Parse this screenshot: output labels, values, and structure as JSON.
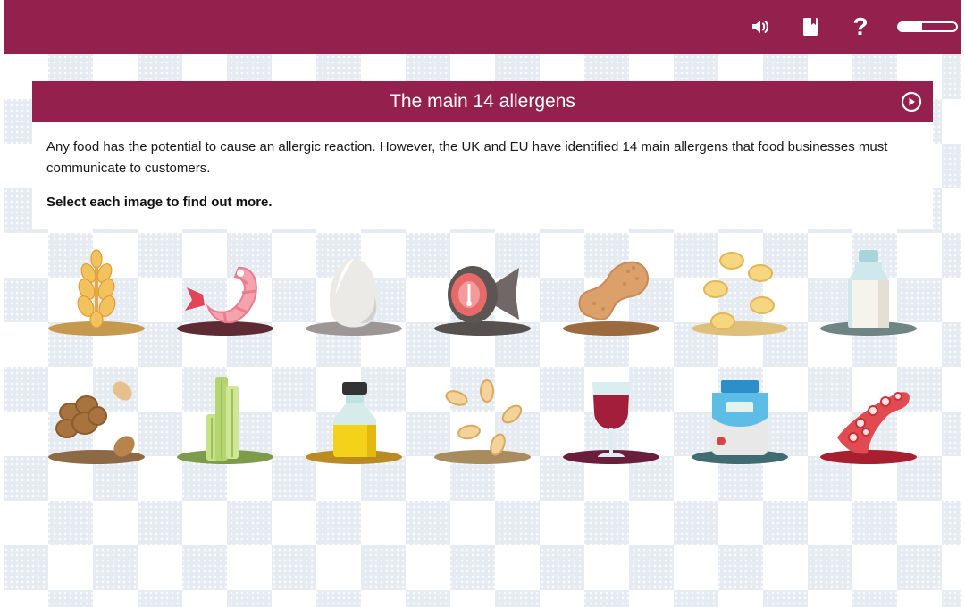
{
  "topbar": {
    "icons": [
      "speaker-icon",
      "bookmark-book-icon",
      "help-question-icon"
    ],
    "help_glyph": "?",
    "progress_fraction": 0.4,
    "color": "#93204d"
  },
  "card": {
    "title": "The main 14 allergens",
    "intro": "Any food has the potential to cause an allergic reaction. However, the UK and EU have identified 14 main allergens that food businesses must communicate to customers.",
    "instruction": "Select each image to find out more."
  },
  "allergens": [
    {
      "icon": "wheat-icon",
      "base_color": "#c69a4e"
    },
    {
      "icon": "prawn-icon",
      "base_color": "#5e2a33"
    },
    {
      "icon": "egg-icon",
      "base_color": "#9c9696"
    },
    {
      "icon": "fish-icon",
      "base_color": "#56504f"
    },
    {
      "icon": "peanut-icon",
      "base_color": "#9b6a3e"
    },
    {
      "icon": "soya-beans-icon",
      "base_color": "#dfc07a"
    },
    {
      "icon": "milk-bottle-icon",
      "base_color": "#6f8583"
    },
    {
      "icon": "nuts-icon",
      "base_color": "#8e6945"
    },
    {
      "icon": "celery-icon",
      "base_color": "#7e9b49"
    },
    {
      "icon": "mustard-bottle-icon",
      "base_color": "#b98b21"
    },
    {
      "icon": "sesame-seeds-icon",
      "base_color": "#a88c5f"
    },
    {
      "icon": "wine-glass-icon",
      "base_color": "#6b1e3c"
    },
    {
      "icon": "lupin-flour-pack-icon",
      "base_color": "#416b72"
    },
    {
      "icon": "octopus-tentacle-icon",
      "base_color": "#a82030"
    }
  ]
}
